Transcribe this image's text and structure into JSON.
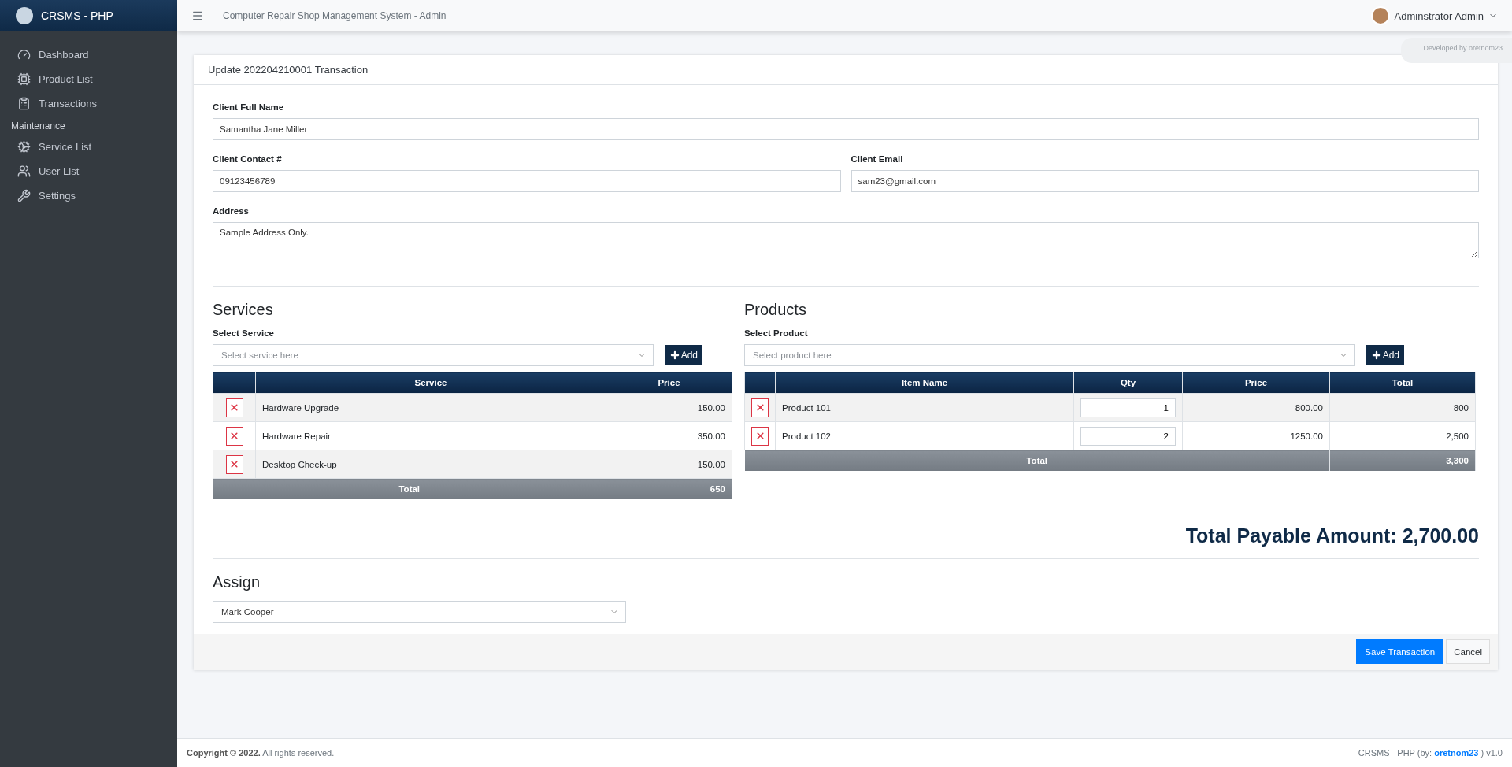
{
  "brand": {
    "title": "CRSMS - PHP"
  },
  "sidebar": {
    "items": [
      {
        "label": "Dashboard"
      },
      {
        "label": "Product List"
      },
      {
        "label": "Transactions"
      }
    ],
    "section": "Maintenance",
    "maintenance_items": [
      {
        "label": "Service List"
      },
      {
        "label": "User List"
      },
      {
        "label": "Settings"
      }
    ]
  },
  "header": {
    "title": "Computer Repair Shop Management System - Admin",
    "user": "Adminstrator Admin",
    "credit": "Developed by oretnom23"
  },
  "card": {
    "title": "Update 202204210001 Transaction",
    "client_name": {
      "label": "Client Full Name",
      "value": "Samantha Jane Miller"
    },
    "client_contact": {
      "label": "Client Contact #",
      "value": "09123456789"
    },
    "client_email": {
      "label": "Client Email",
      "value": "sam23@gmail.com"
    },
    "address": {
      "label": "Address",
      "value": "Sample Address Only."
    },
    "services": {
      "heading": "Services",
      "select_label": "Select Service",
      "placeholder": "Select service here",
      "add": "Add",
      "columns": [
        "Service",
        "Price"
      ],
      "rows": [
        {
          "name": "Hardware Upgrade",
          "price": "150.00"
        },
        {
          "name": "Hardware Repair",
          "price": "350.00"
        },
        {
          "name": "Desktop Check-up",
          "price": "150.00"
        }
      ],
      "total_label": "Total",
      "total": "650"
    },
    "products": {
      "heading": "Products",
      "select_label": "Select Product",
      "placeholder": "Select product here",
      "add": "Add",
      "columns": [
        "Item Name",
        "Qty",
        "Price",
        "Total"
      ],
      "rows": [
        {
          "name": "Product 101",
          "qty": "1",
          "price": "800.00",
          "total": "800"
        },
        {
          "name": "Product 102",
          "qty": "2",
          "price": "1250.00",
          "total": "2,500"
        }
      ],
      "total_label": "Total",
      "total": "3,300"
    },
    "payable": "Total Payable Amount: 2,700.00",
    "assign": {
      "heading": "Assign",
      "value": "Mark Cooper"
    },
    "buttons": {
      "save": "Save Transaction",
      "cancel": "Cancel"
    }
  },
  "footer": {
    "copyright": "Copyright © 2022.",
    "rights": "All rights reserved.",
    "credit_prefix": "CRSMS - PHP (by: ",
    "credit_link": "oretnom23",
    "credit_suffix": " ) v1.0"
  }
}
